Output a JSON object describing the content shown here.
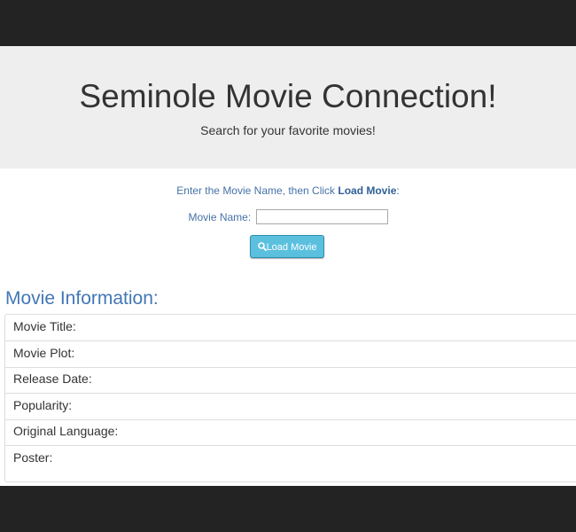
{
  "header": {
    "title": "Seminole Movie Connection!",
    "subtitle": "Search for your favorite movies!"
  },
  "search": {
    "instruction_prefix": "Enter the Movie Name, then Click ",
    "instruction_bold": "Load Movie",
    "instruction_suffix": ":",
    "field_label": "Movie Name:",
    "field_value": "",
    "button_label": "Load Movie",
    "button_icon": "search-icon"
  },
  "movie_info": {
    "heading": "Movie Information:",
    "rows": [
      {
        "label": "Movie Title:"
      },
      {
        "label": "Movie Plot:"
      },
      {
        "label": "Release Date:"
      },
      {
        "label": "Popularity:"
      },
      {
        "label": "Original Language:"
      },
      {
        "label": "Poster:"
      }
    ]
  },
  "colors": {
    "background_dark": "#232323",
    "jumbotron": "#eeeeee",
    "accent_blue": "#4377b5",
    "button_info": "#5bc0de"
  }
}
